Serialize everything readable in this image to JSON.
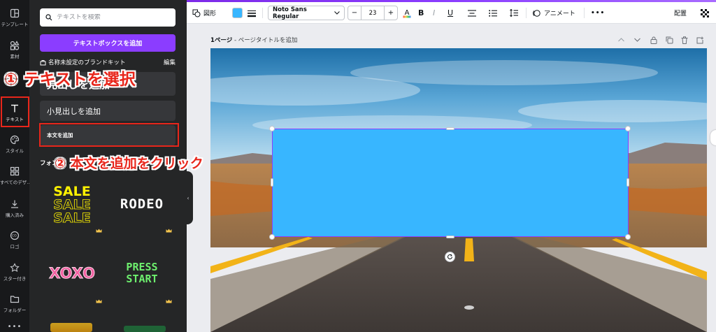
{
  "rail": {
    "items": [
      {
        "label": "テンプレート",
        "icon": "template-icon"
      },
      {
        "label": "素材",
        "icon": "elements-icon"
      },
      {
        "label": "テキスト",
        "icon": "text-icon"
      },
      {
        "label": "スタイル",
        "icon": "palette-icon"
      },
      {
        "label": "すべてのデザ…",
        "icon": "grid-icon"
      },
      {
        "label": "購入済み",
        "icon": "download-icon"
      },
      {
        "label": "ロゴ",
        "icon": "logo-icon"
      },
      {
        "label": "スター付き",
        "icon": "star-icon"
      },
      {
        "label": "フォルダー",
        "icon": "folder-icon"
      }
    ],
    "more": "•••"
  },
  "panel": {
    "search_placeholder": "テキストを検索",
    "add_textbox_label": "テキストボックスを追加",
    "brandkit_label": "名称未設定のブランドキット",
    "edit_label": "編集",
    "heading_label": "見出しを追加",
    "subheading_label": "小見出しを追加",
    "body_label": "本文を追加",
    "fonts_label": "フォント",
    "font_tiles": [
      "SALE",
      "RODEO",
      "XOXO",
      "PRESS START"
    ]
  },
  "toolbar": {
    "shape_label": "図形",
    "font_name": "Noto Sans Regular",
    "font_size": "23",
    "minus": "−",
    "plus": "+",
    "animate_label": "アニメート",
    "more_label": "•••",
    "arrange_label": "配置",
    "fill_color": "#38b6ff"
  },
  "page": {
    "number_label": "1ページ",
    "title_placeholder": " - ページタイトルを追加"
  },
  "annotations": {
    "step1": "① テキストを選択",
    "step2": "② 本文を追加をクリック",
    "color": "#e8261b"
  }
}
